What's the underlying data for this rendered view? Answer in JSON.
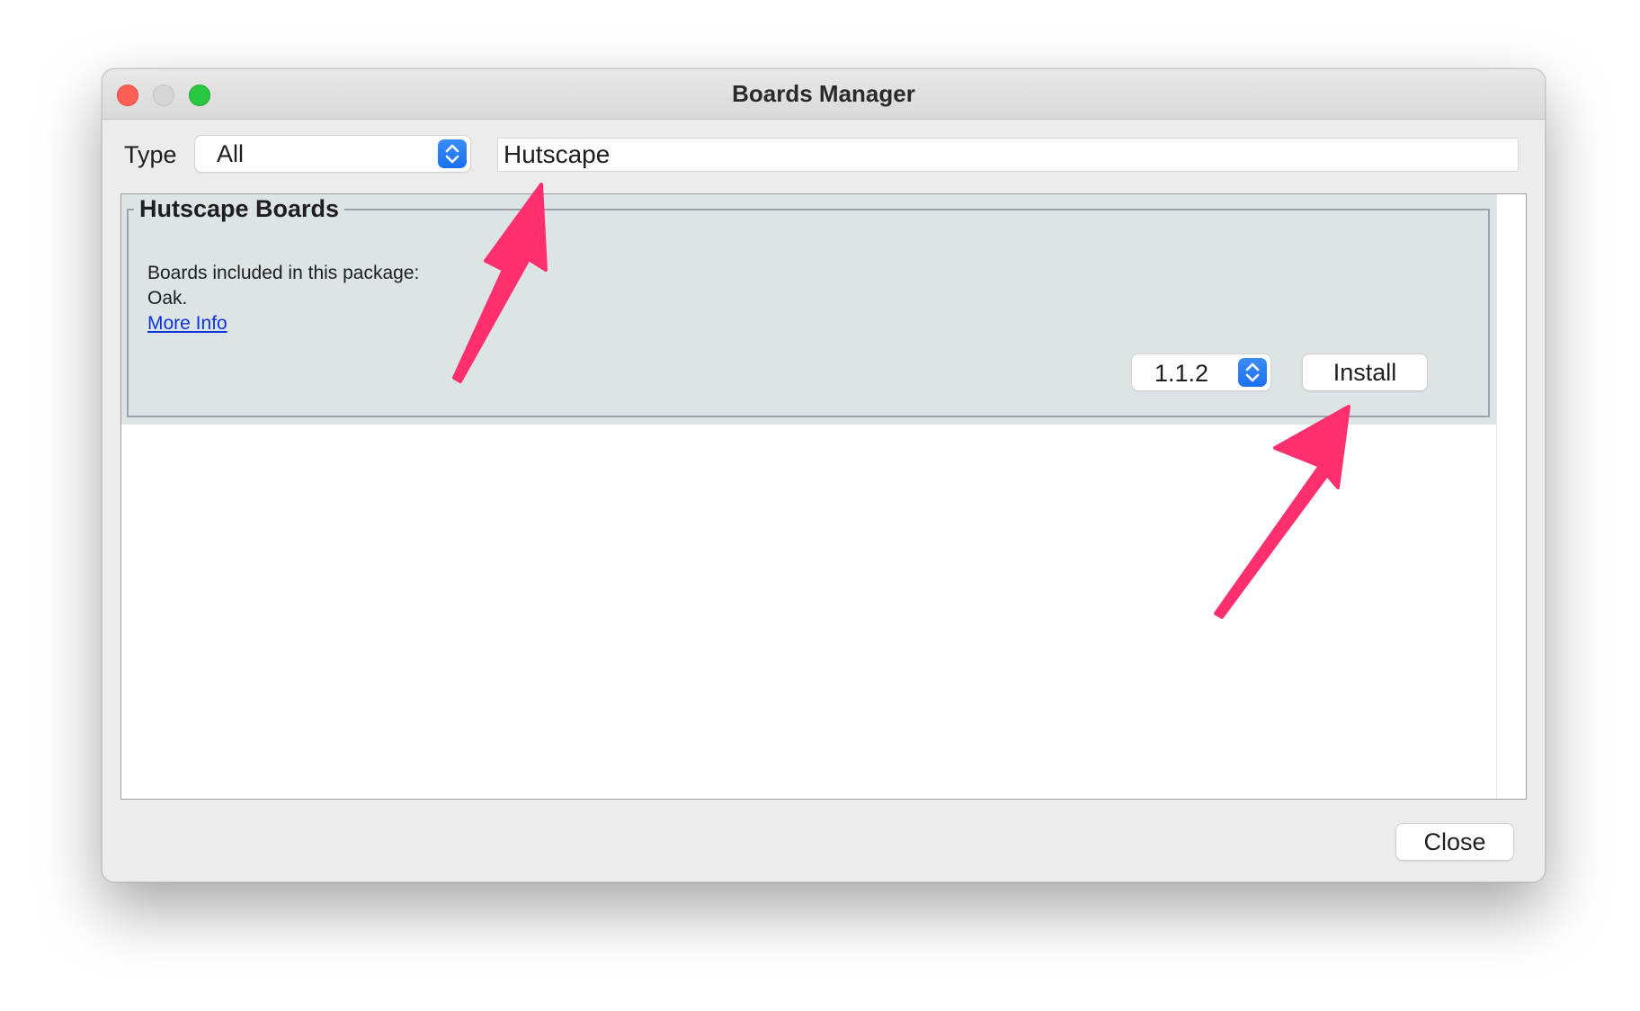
{
  "window": {
    "title": "Boards Manager"
  },
  "filter": {
    "type_label": "Type",
    "type_value": "All",
    "search_value": "Hutscape"
  },
  "package": {
    "name": "Hutscape Boards",
    "boards_heading": "Boards included in this package:",
    "boards_list": "Oak.",
    "more_info_label": "More Info",
    "version": "1.1.2",
    "install_label": "Install"
  },
  "footer": {
    "close_label": "Close"
  },
  "colors": {
    "arrow": "#ff2f6e",
    "link": "#0b35d9",
    "stepper": "#1a6ff0",
    "package_background": "#dce4e6"
  },
  "icons": {
    "stepper": "chevron-up-down-icon",
    "annotation": "arrow-icon"
  }
}
